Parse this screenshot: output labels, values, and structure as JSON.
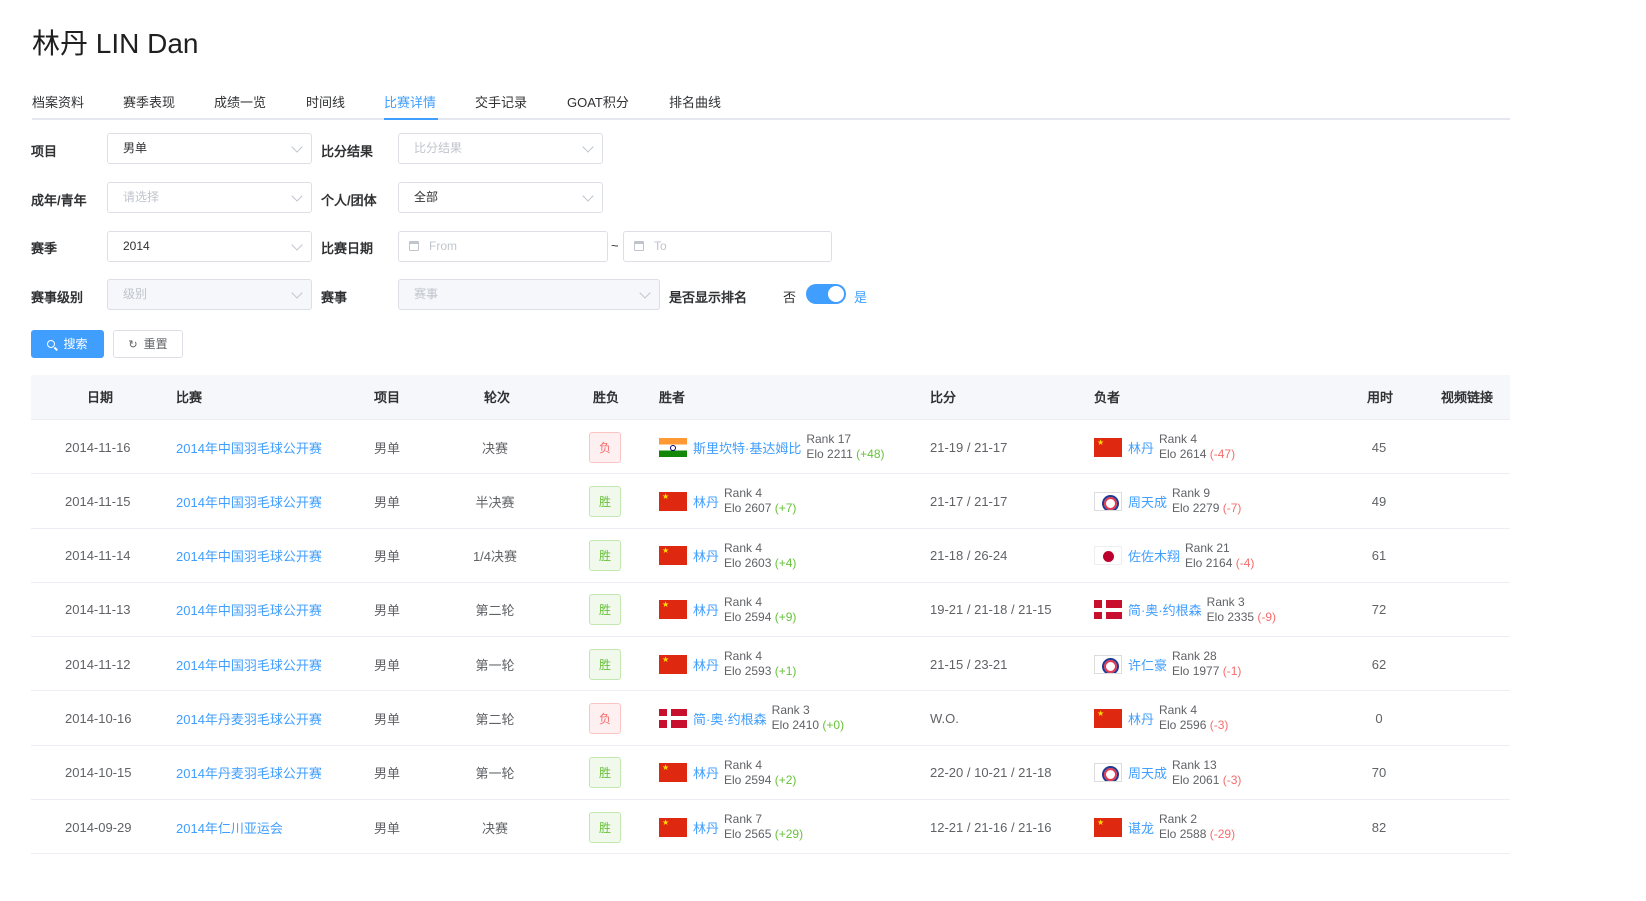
{
  "title": "林丹 LIN Dan",
  "tabs": [
    {
      "label": "档案资料",
      "active": false
    },
    {
      "label": "赛季表现",
      "active": false
    },
    {
      "label": "成绩一览",
      "active": false
    },
    {
      "label": "时间线",
      "active": false
    },
    {
      "label": "比赛详情",
      "active": true
    },
    {
      "label": "交手记录",
      "active": false
    },
    {
      "label": "GOAT积分",
      "active": false
    },
    {
      "label": "排名曲线",
      "active": false
    }
  ],
  "filters": {
    "event": {
      "label": "项目",
      "value": "男单"
    },
    "score_result": {
      "label": "比分结果",
      "placeholder": "比分结果"
    },
    "age_group": {
      "label": "成年/青年",
      "placeholder": "请选择"
    },
    "individual_team": {
      "label": "个人/团体",
      "value": "全部"
    },
    "season": {
      "label": "赛季",
      "value": "2014"
    },
    "match_date": {
      "label": "比赛日期",
      "from_placeholder": "From",
      "separator": "~",
      "to_placeholder": "To"
    },
    "level": {
      "label": "赛事级别",
      "placeholder": "级别"
    },
    "tournament": {
      "label": "赛事",
      "placeholder": "赛事"
    },
    "show_rank": {
      "label": "是否显示排名",
      "off_label": "否",
      "on_label": "是",
      "on": true
    }
  },
  "buttons": {
    "search": "搜索",
    "reset": "重置"
  },
  "table": {
    "headers": {
      "date": "日期",
      "match": "比赛",
      "event": "项目",
      "round": "轮次",
      "result": "胜负",
      "winner": "胜者",
      "score": "比分",
      "loser": "负者",
      "duration": "用时",
      "video": "视频链接"
    },
    "rows": [
      {
        "date": "2014-11-16",
        "match": "2014年中国羽毛球公开赛",
        "event": "男单",
        "round": "决赛",
        "result": "负",
        "result_type": "lose",
        "winner": {
          "flag": "india-flag",
          "name": "斯里坎特·基达姆比",
          "rank": "Rank 17",
          "elo": "Elo 2211 ",
          "delta": "(+48)",
          "delta_type": "pos"
        },
        "score": "21-19 / 21-17",
        "loser": {
          "flag": "china-flag",
          "name": "林丹",
          "rank": "Rank 4",
          "elo": "Elo 2614 ",
          "delta": "(-47)",
          "delta_type": "neg"
        },
        "duration": "45"
      },
      {
        "date": "2014-11-15",
        "match": "2014年中国羽毛球公开赛",
        "event": "男单",
        "round": "半决赛",
        "result": "胜",
        "result_type": "win",
        "winner": {
          "flag": "china-flag",
          "name": "林丹",
          "rank": "Rank 4",
          "elo": "Elo 2607 ",
          "delta": "(+7)",
          "delta_type": "pos"
        },
        "score": "21-17 / 21-17",
        "loser": {
          "flag": "chinese-taipei-flag",
          "name": "周天成",
          "rank": "Rank 9",
          "elo": "Elo 2279 ",
          "delta": "(-7)",
          "delta_type": "neg"
        },
        "duration": "49"
      },
      {
        "date": "2014-11-14",
        "match": "2014年中国羽毛球公开赛",
        "event": "男单",
        "round": "1/4决赛",
        "result": "胜",
        "result_type": "win",
        "winner": {
          "flag": "china-flag",
          "name": "林丹",
          "rank": "Rank 4",
          "elo": "Elo 2603 ",
          "delta": "(+4)",
          "delta_type": "pos"
        },
        "score": "21-18 / 26-24",
        "loser": {
          "flag": "japan-flag",
          "name": "佐佐木翔",
          "rank": "Rank 21",
          "elo": "Elo 2164 ",
          "delta": "(-4)",
          "delta_type": "neg"
        },
        "duration": "61"
      },
      {
        "date": "2014-11-13",
        "match": "2014年中国羽毛球公开赛",
        "event": "男单",
        "round": "第二轮",
        "result": "胜",
        "result_type": "win",
        "winner": {
          "flag": "china-flag",
          "name": "林丹",
          "rank": "Rank 4",
          "elo": "Elo 2594 ",
          "delta": "(+9)",
          "delta_type": "pos"
        },
        "score": "19-21 / 21-18 / 21-15",
        "loser": {
          "flag": "denmark-flag",
          "name": "简·奥·约根森",
          "rank": "Rank 3",
          "elo": "Elo 2335 ",
          "delta": "(-9)",
          "delta_type": "neg"
        },
        "duration": "72"
      },
      {
        "date": "2014-11-12",
        "match": "2014年中国羽毛球公开赛",
        "event": "男单",
        "round": "第一轮",
        "result": "胜",
        "result_type": "win",
        "winner": {
          "flag": "china-flag",
          "name": "林丹",
          "rank": "Rank 4",
          "elo": "Elo 2593 ",
          "delta": "(+1)",
          "delta_type": "pos"
        },
        "score": "21-15 / 23-21",
        "loser": {
          "flag": "chinese-taipei-flag",
          "name": "许仁豪",
          "rank": "Rank 28",
          "elo": "Elo 1977 ",
          "delta": "(-1)",
          "delta_type": "neg"
        },
        "duration": "62"
      },
      {
        "date": "2014-10-16",
        "match": "2014年丹麦羽毛球公开赛",
        "event": "男单",
        "round": "第二轮",
        "result": "负",
        "result_type": "lose",
        "winner": {
          "flag": "denmark-flag",
          "name": "简·奥·约根森",
          "rank": "Rank 3",
          "elo": "Elo 2410 ",
          "delta": "(+0)",
          "delta_type": "pos"
        },
        "score": "W.O.",
        "loser": {
          "flag": "china-flag",
          "name": "林丹",
          "rank": "Rank 4",
          "elo": "Elo 2596 ",
          "delta": "(-3)",
          "delta_type": "neg"
        },
        "duration": "0"
      },
      {
        "date": "2014-10-15",
        "match": "2014年丹麦羽毛球公开赛",
        "event": "男单",
        "round": "第一轮",
        "result": "胜",
        "result_type": "win",
        "winner": {
          "flag": "china-flag",
          "name": "林丹",
          "rank": "Rank 4",
          "elo": "Elo 2594 ",
          "delta": "(+2)",
          "delta_type": "pos"
        },
        "score": "22-20 / 10-21 / 21-18",
        "loser": {
          "flag": "chinese-taipei-flag",
          "name": "周天成",
          "rank": "Rank 13",
          "elo": "Elo 2061 ",
          "delta": "(-3)",
          "delta_type": "neg"
        },
        "duration": "70"
      },
      {
        "date": "2014-09-29",
        "match": "2014年仁川亚运会",
        "event": "男单",
        "round": "决赛",
        "result": "胜",
        "result_type": "win",
        "winner": {
          "flag": "china-flag",
          "name": "林丹",
          "rank": "Rank 7",
          "elo": "Elo 2565 ",
          "delta": "(+29)",
          "delta_type": "pos"
        },
        "score": "12-21 / 21-16 / 21-16",
        "loser": {
          "flag": "china-flag",
          "name": "谌龙",
          "rank": "Rank 2",
          "elo": "Elo 2588 ",
          "delta": "(-29)",
          "delta_type": "neg"
        },
        "duration": "82"
      }
    ]
  },
  "colors": {
    "accent": "#409eff",
    "win": "#67c23a",
    "lose": "#f56c6c"
  }
}
